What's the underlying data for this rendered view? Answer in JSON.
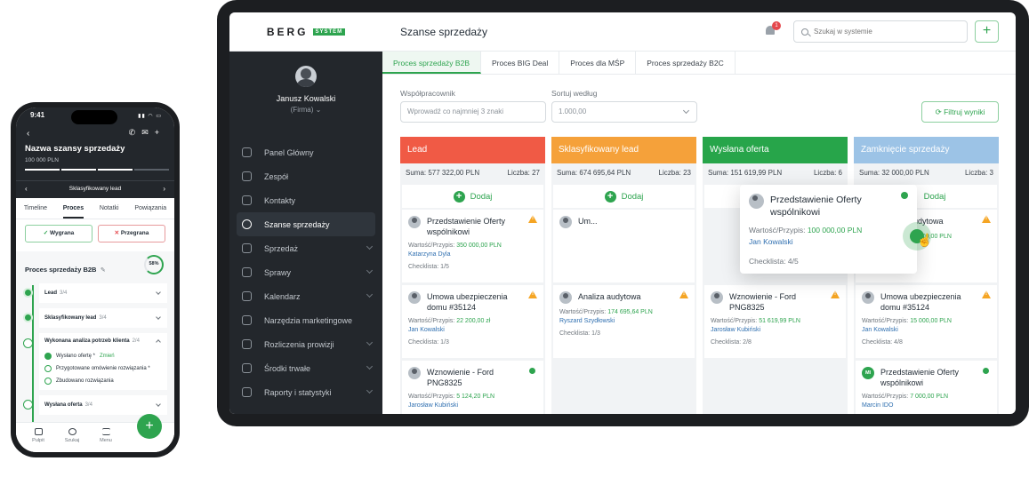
{
  "app": {
    "brand": "BERG",
    "brand_tag": "SYSTEM",
    "page_title": "Szanse sprzedaży",
    "notification_count": "1",
    "search_placeholder": "Szukaj w systemie",
    "add_label": "+"
  },
  "profile": {
    "name": "Janusz Kowalski",
    "role": "(Firma)"
  },
  "sidebar": {
    "items": [
      {
        "label": "Panel Główny",
        "icon": "home-icon",
        "chevron": false
      },
      {
        "label": "Zespół",
        "icon": "team-icon",
        "chevron": false
      },
      {
        "label": "Kontakty",
        "icon": "contacts-icon",
        "chevron": false
      },
      {
        "label": "Szanse sprzedaży",
        "icon": "target-icon",
        "chevron": false,
        "active": true
      },
      {
        "label": "Sprzedaż",
        "icon": "cart-icon",
        "chevron": true
      },
      {
        "label": "Sprawy",
        "icon": "folder-icon",
        "chevron": true
      },
      {
        "label": "Kalendarz",
        "icon": "calendar-icon",
        "chevron": true
      },
      {
        "label": "Narzędzia marketingowe",
        "icon": "megaphone-icon",
        "chevron": false
      },
      {
        "label": "Rozliczenia prowizji",
        "icon": "dollar-icon",
        "chevron": true
      },
      {
        "label": "Środki trwałe",
        "icon": "truck-icon",
        "chevron": true
      },
      {
        "label": "Raporty i statystyki",
        "icon": "chart-icon",
        "chevron": true
      }
    ]
  },
  "tabs": [
    {
      "label": "Proces sprzedaży B2B",
      "active": true
    },
    {
      "label": "Proces BIG Deal"
    },
    {
      "label": "Proces dla MŚP"
    },
    {
      "label": "Proces sprzedaży B2C"
    }
  ],
  "filters": {
    "coworker_label": "Współpracownik",
    "coworker_placeholder": "Wprowadź co najmniej 3 znaki",
    "sort_label": "Sortuj według",
    "sort_value": "1.000,00",
    "filter_button": "Filtruj wyniki"
  },
  "columns": [
    {
      "title": "Lead",
      "color": "#f05a45",
      "sum": "Suma: 577 322,00 PLN",
      "count": "Liczba: 27",
      "add": "Dodaj",
      "deals": [
        {
          "title": "Przedstawienie Oferty wspólnikowi",
          "meta": "Wartość/Przypis: ",
          "value": "350 000,00 PLN",
          "person": "Katarzyna Dyla",
          "check": "Checklista: 1/5",
          "flag": "warn"
        },
        {
          "title": "Umowa ubezpieczenia domu #35124",
          "meta": "Wartość/Przypis: ",
          "value": "22 200,00 zł",
          "person": "Jan Kowalski",
          "check": "Checklista: 1/3",
          "flag": "warn"
        },
        {
          "title": "Wznowienie - Ford PNG8325",
          "meta": "Wartość/Przypis: ",
          "value": "5 124,20 PLN",
          "person": "Jarosław Kubiński",
          "check": "",
          "flag": "dot"
        }
      ]
    },
    {
      "title": "Sklasyfikowany lead",
      "color": "#f5a13a",
      "sum": "Suma: 674 695,64 PLN",
      "count": "Liczba: 23",
      "add": "Dodaj",
      "deals": [
        {
          "title": "Um...",
          "meta": "",
          "value": "",
          "person": "",
          "check": "",
          "flag": ""
        },
        {
          "title": "Analiza audytowa",
          "meta": "Wartość/Przypis: ",
          "value": "174 695,64 PLN",
          "person": "Ryszard Szydłowski",
          "check": "Checklista: 1/3",
          "flag": "warn"
        }
      ]
    },
    {
      "title": "Wysłana oferta",
      "color": "#27a54a",
      "sum": "Suma: 151 619,99 PLN",
      "count": "Liczba: 6",
      "add": "Dodaj",
      "deals": [
        {
          "title": "",
          "meta": "",
          "value": "",
          "person": "",
          "check": "",
          "flag": ""
        },
        {
          "title": "Wznowienie - Ford PNG8325",
          "meta": "Wartość/Przypis: ",
          "value": "51 619,99 PLN",
          "person": "Jarosław Kubiński",
          "check": "Checklista: 2/8",
          "flag": "warn"
        }
      ]
    },
    {
      "title": "Zamknięcie sprzedaży",
      "color": "#9cc3e6",
      "sum": "Suma: 32 000,00 PLN",
      "count": "Liczba: 3",
      "add": "Dodaj",
      "deals": [
        {
          "title": "Analiza audytowa",
          "meta": "Wartość/Przypis: ",
          "value": "10 000,00 PLN",
          "person": "Ryszard Szydłowski",
          "check": "Checklista: 3/7",
          "flag": "warn"
        },
        {
          "title": "Umowa ubezpieczenia domu #35124",
          "meta": "Wartość/Przypis: ",
          "value": "15 000,00 PLN",
          "person": "Jan Kowalski",
          "check": "Checklista: 4/8",
          "flag": "warn"
        },
        {
          "title": "Przedstawienie Oferty wspólnikowi",
          "meta": "Wartość/Przypis: ",
          "value": "7 000,00 PLN",
          "person": "Marcin IDO",
          "check": "Checklista: 2/10",
          "flag": "dot",
          "initials": "MI"
        }
      ]
    }
  ],
  "popup": {
    "title": "Przedstawienie Oferty wspólnikowi",
    "meta": "Wartość/Przypis: ",
    "value": "100 000,00 PLN",
    "person": "Jan Kowalski",
    "check": "Checklista: 4/5"
  },
  "phone": {
    "time": "9:41",
    "title": "Nazwa szansy sprzedaży",
    "amount": "100 000 PLN",
    "stage": "Sklasyfikowany lead",
    "tabs": [
      "Timeline",
      "Proces",
      "Notatki",
      "Powiązania"
    ],
    "won": "Wygrana",
    "lost": "Przegrana",
    "process_title": "Proces sprzedaży B2B",
    "progress": "58%",
    "rows": [
      {
        "label": "Lead",
        "count": "3/4"
      },
      {
        "label": "Sklasyfikowany lead",
        "count": "3/4"
      },
      {
        "label": "Wykonana analiza potrzeb klienta",
        "count": "2/4"
      }
    ],
    "subtasks": [
      {
        "label": "Wysłano ofertę *",
        "change": "Zmień",
        "done": true
      },
      {
        "label": "Przygotowane omówienie rozwiązania *",
        "change": "",
        "done": false
      },
      {
        "label": "Zbudowano rozwiązania",
        "change": "",
        "done": false
      }
    ],
    "last_row": {
      "label": "Wysłana oferta",
      "count": "3/4"
    },
    "bottom_nav": [
      "Pulpit",
      "Szukaj",
      "Menu"
    ]
  }
}
